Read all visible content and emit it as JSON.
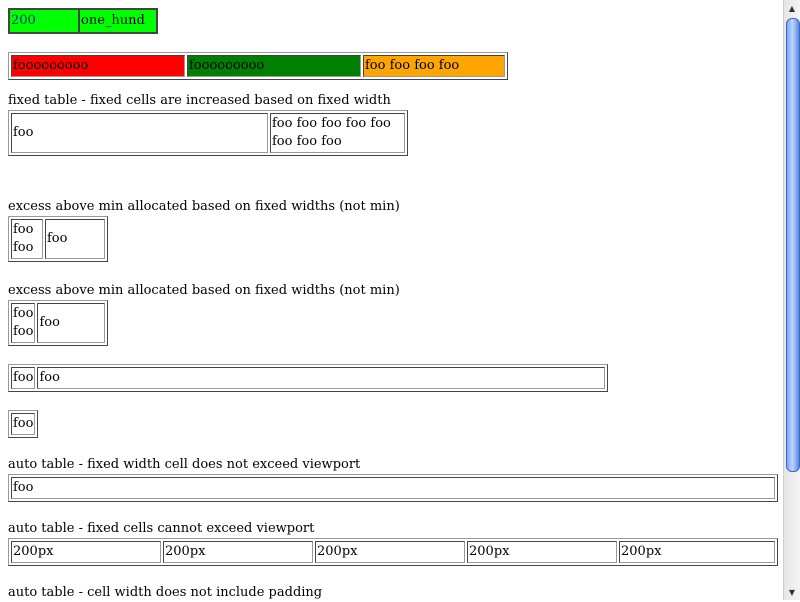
{
  "tables": {
    "t1": [
      "200",
      "one_hund"
    ],
    "t2": [
      {
        "text": "fooooooooo",
        "color": "#ff0000"
      },
      {
        "text": "fooooooooo",
        "color": "#008000"
      },
      {
        "text": "foo foo foo foo",
        "color": "#ffa500"
      }
    ],
    "t3": {
      "caption": "fixed table - fixed cells are increased based on fixed width",
      "cells": [
        "foo",
        "foo foo foo foo foo foo foo foo"
      ]
    },
    "t4": {
      "caption": "excess above min allocated based on fixed widths (not min)",
      "cells": [
        "foo foo",
        "foo"
      ]
    },
    "t5": {
      "caption": "excess above min allocated based on fixed widths (not min)",
      "cells": [
        "foo foo",
        "foo"
      ]
    },
    "t6": [
      "foo",
      "foo"
    ],
    "t7": [
      "foo"
    ],
    "t8": {
      "caption": "auto table - fixed width cell does not exceed viewport",
      "cells": [
        "foo"
      ]
    },
    "t9": {
      "caption": "auto table - fixed cells cannot exceed viewport",
      "cells": [
        "200px",
        "200px",
        "200px",
        "200px",
        "200px"
      ]
    },
    "t10": {
      "caption": "auto table - cell width does not include padding"
    }
  },
  "scrollbar": {
    "up_icon": "▲",
    "down_icon": "▼"
  }
}
